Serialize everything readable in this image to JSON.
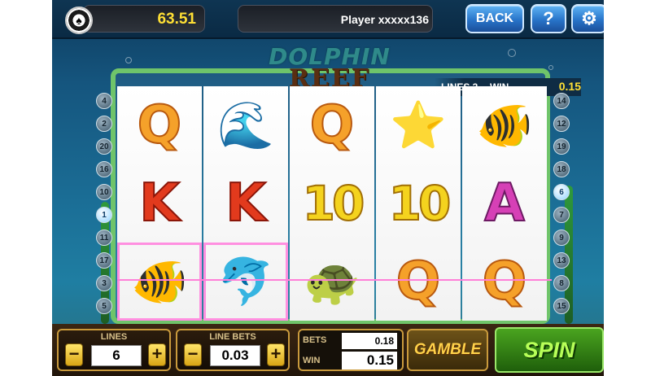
{
  "header": {
    "balance": "63.51",
    "player": "Player xxxxx136",
    "back_label": "BACK",
    "help_label": "?",
    "settings_icon": "gear-icon"
  },
  "logo": {
    "line1": "DOLPHIN",
    "line2": "REEF"
  },
  "info": {
    "lines_label": "LINES 3",
    "win_label": "WIN",
    "win_value": "0.15"
  },
  "reels": [
    [
      "Q",
      "K",
      "clownfish"
    ],
    [
      "seahorse",
      "K",
      "dolphin"
    ],
    [
      "Q",
      "10",
      "turtle"
    ],
    [
      "starfish",
      "10",
      "Q"
    ],
    [
      "clownfish",
      "A",
      "Q"
    ]
  ],
  "symbol_glyphs": {
    "clownfish": "🐠",
    "seahorse": "🌊",
    "dolphin": "🐬",
    "turtle": "🐢",
    "starfish": "⭐"
  },
  "highlighted": [
    [
      0,
      2
    ],
    [
      1,
      2
    ]
  ],
  "left_markers": [
    "4",
    "2",
    "20",
    "16",
    "10",
    "1",
    "11",
    "17",
    "3",
    "5"
  ],
  "right_markers": [
    "14",
    "12",
    "19",
    "18",
    "6",
    "7",
    "9",
    "13",
    "8",
    "15"
  ],
  "active_markers": [
    "1",
    "6"
  ],
  "controls": {
    "lines_title": "LINES",
    "lines_value": "6",
    "linebets_title": "LINE BETS",
    "linebets_value": "0.03",
    "bets_label": "BETS",
    "bets_value": "0.18",
    "win_label": "WIN",
    "win_value": "0.15",
    "minus": "−",
    "plus": "+"
  },
  "buttons": {
    "gamble": "GAMBLE",
    "spin": "SPIN"
  }
}
